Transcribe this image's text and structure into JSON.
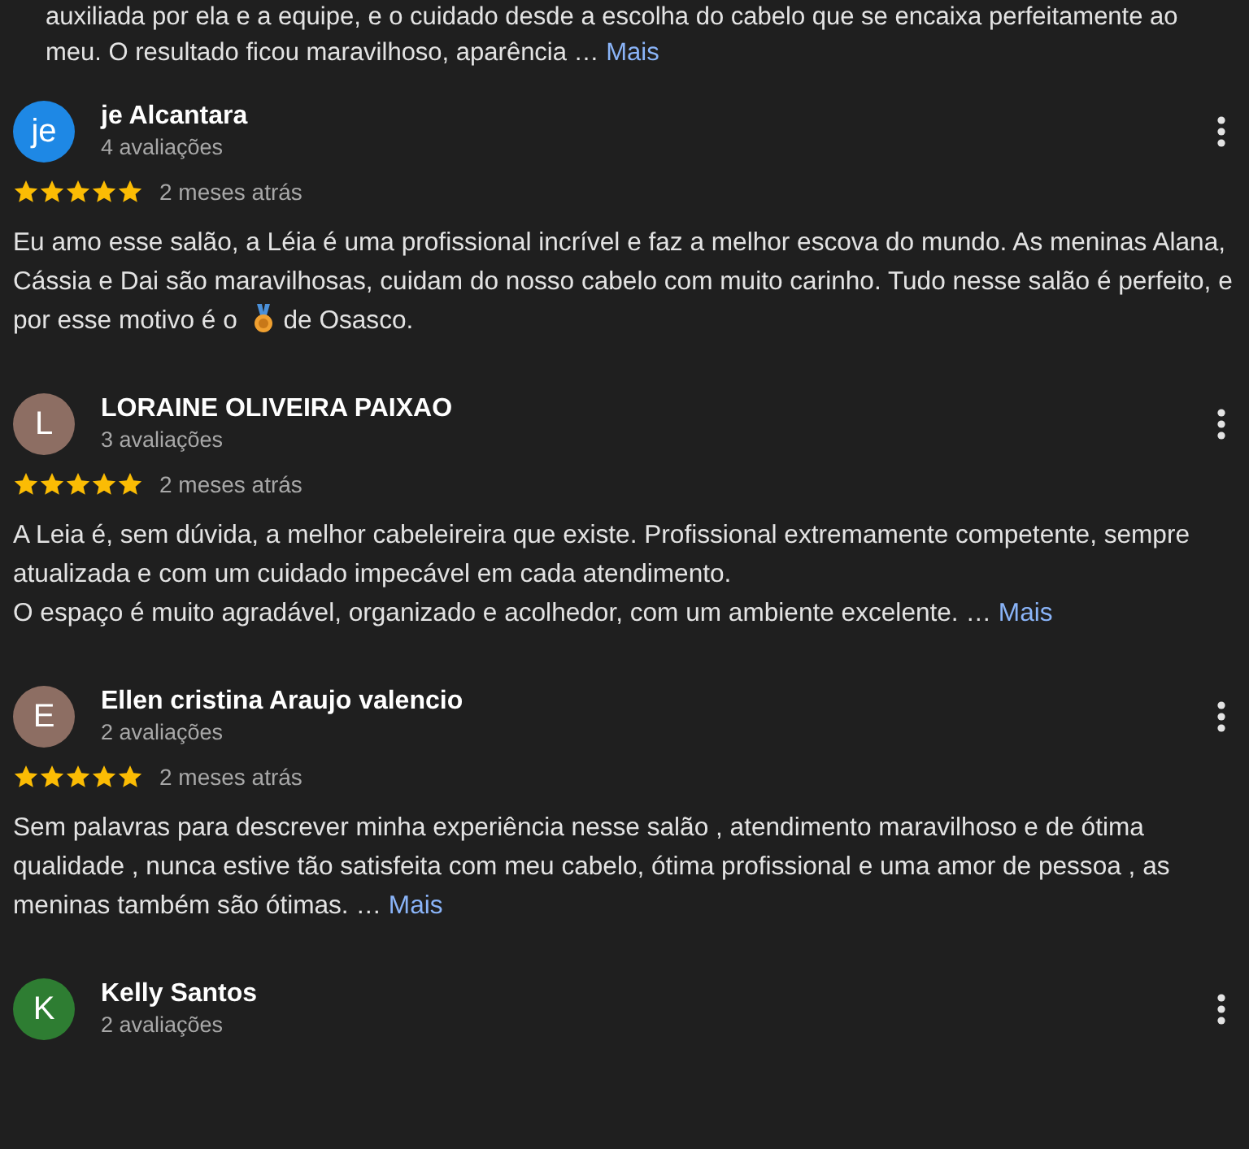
{
  "top_review": {
    "lines": [
      "auxiliada por ela e a equipe, e o cuidado desde a escolha do cabelo que se encaixa perfeitamente ao",
      "meu. O resultado ficou maravilhoso, aparência …"
    ],
    "more": "Mais"
  },
  "reviews": [
    {
      "initial": "je",
      "color": "#1e88e5",
      "name": "je Alcantara",
      "count": "4 avaliações",
      "stars": 5,
      "date": "2 meses atrás",
      "body": [
        {
          "kind": "text",
          "text": "Eu amo esse salão, a Léia é uma profissional incrível e faz a melhor escova do mundo. As meninas Alana, Cássia e Dai são maravilhosas, cuidam do nosso cabelo com muito carinho. Tudo nesse salão é perfeito, e por esse motivo é o"
        },
        {
          "kind": "medal"
        },
        {
          "kind": "text",
          "text": "de Osasco."
        }
      ]
    },
    {
      "initial": "L",
      "color": "#8d6e63",
      "name": "LORAINE OLIVEIRA PAIXAO",
      "count": "3 avaliações",
      "stars": 5,
      "date": "2 meses atrás",
      "body": [
        {
          "kind": "text",
          "text": "A Leia é, sem dúvida, a melhor cabeleireira que existe. Profissional extremamente competente, sempre atualizada e com um cuidado impecável em cada atendimento."
        },
        {
          "kind": "break"
        },
        {
          "kind": "text",
          "text": "O espaço é muito agradável, organizado e acolhedor, com um ambiente excelente. …"
        }
      ],
      "more": "Mais"
    },
    {
      "initial": "E",
      "color": "#8d6e63",
      "name": "Ellen cristina Araujo valencio",
      "count": "2 avaliações",
      "stars": 5,
      "date": "2 meses atrás",
      "body": [
        {
          "kind": "text",
          "text": "Sem palavras para descrever minha experiência nesse salão , atendimento maravilhoso e de ótima qualidade , nunca estive tão satisfeita com meu cabelo, ótima profissional e uma amor de pessoa , as meninas também são ótimas. …"
        }
      ],
      "more": "Mais"
    },
    {
      "initial": "K",
      "color": "#2e7d32",
      "name": "Kelly Santos",
      "count": "2 avaliações"
    }
  ]
}
